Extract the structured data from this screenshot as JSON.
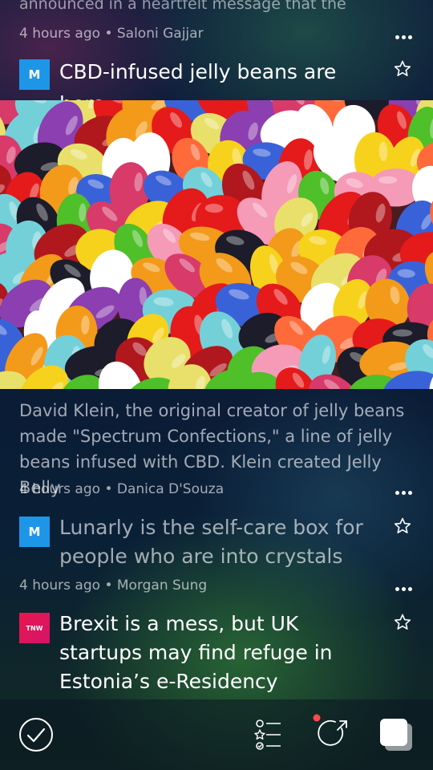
{
  "feed": {
    "prev_excerpt_tail": "announced in a heartfelt message that the",
    "items": [
      {
        "meta_time": "4 hours ago",
        "meta_author": "Saloni Gajjar",
        "source_badge": "M",
        "title": "CBD-infused jelly beans are here",
        "excerpt": "David Klein, the original creator of jelly beans made \"Spectrum Confections,\" a line of jelly beans infused with CBD. Klein created Jelly Belly"
      },
      {
        "meta_time": "4 hours ago",
        "meta_author": "Danica D'Souza",
        "source_badge": "M",
        "title": "Lunarly is the self-care box for people who are into crystals"
      },
      {
        "meta_time": "4 hours ago",
        "meta_author": "Morgan Sung",
        "source_badge": "TNW",
        "title": "Brexit is a mess, but UK startups may find refuge in Estonia’s e-Residency"
      }
    ]
  },
  "colors": {
    "source_m": "#1e96e8",
    "source_tnw": "#e8184c",
    "notification_dot": "#ff4b4b"
  },
  "icons": {
    "more": "more-dots-icon",
    "star": "star-outline-icon",
    "done": "check-circle-icon",
    "list": "checklist-icon",
    "refresh": "refresh-icon",
    "tabs": "tabs-icon"
  }
}
